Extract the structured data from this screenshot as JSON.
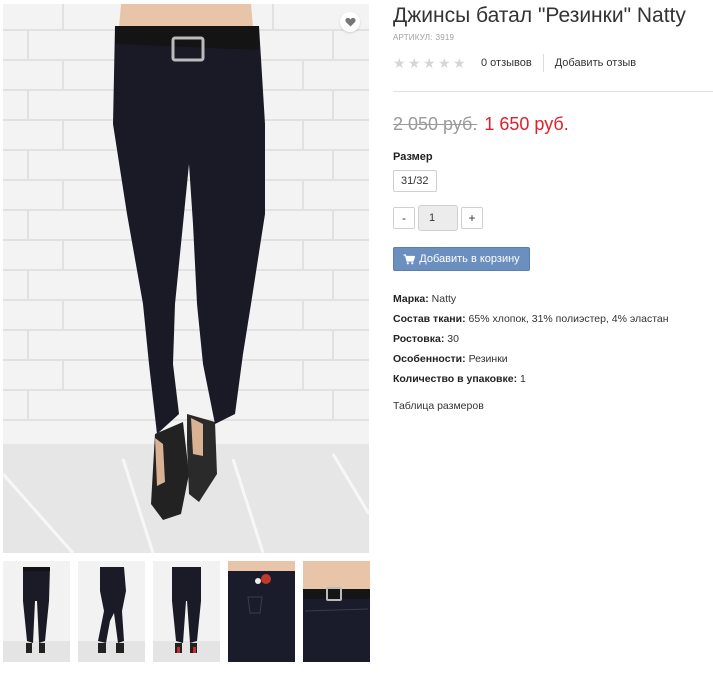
{
  "product": {
    "title": "Джинсы батал \"Резинки\" Natty",
    "sku_label": "АРТИКУЛ:",
    "sku_value": "3919"
  },
  "rating": {
    "stars_filled": 0,
    "stars_total": 5,
    "reviews_count": "0 отзывов",
    "add_review": "Добавить отзыв"
  },
  "price": {
    "old": "2 050 руб.",
    "new": "1 650 руб."
  },
  "size": {
    "label": "Размер",
    "selected": "31/32"
  },
  "quantity": {
    "minus": "-",
    "value": "1",
    "plus": "+"
  },
  "cart_button": {
    "label": "Добавить в корзину",
    "icon": "cart-icon"
  },
  "specs": [
    {
      "label": "Марка:",
      "value": "Natty"
    },
    {
      "label": "Состав ткани:",
      "value": "65% хлопок, 31% полиэстер, 4% эластан"
    },
    {
      "label": "Ростовка:",
      "value": "30"
    },
    {
      "label": "Особенности:",
      "value": "Резинки"
    },
    {
      "label": "Количество в упаковке:",
      "value": "1"
    }
  ],
  "size_table_link": "Таблица размеров",
  "icons": {
    "favorite": "heart-icon",
    "star": "star-icon"
  },
  "colors": {
    "price_new": "#e0202a",
    "price_old": "#9a9a9a",
    "cart_button": "#6b8fbe",
    "star_empty": "#d6d6d6"
  }
}
